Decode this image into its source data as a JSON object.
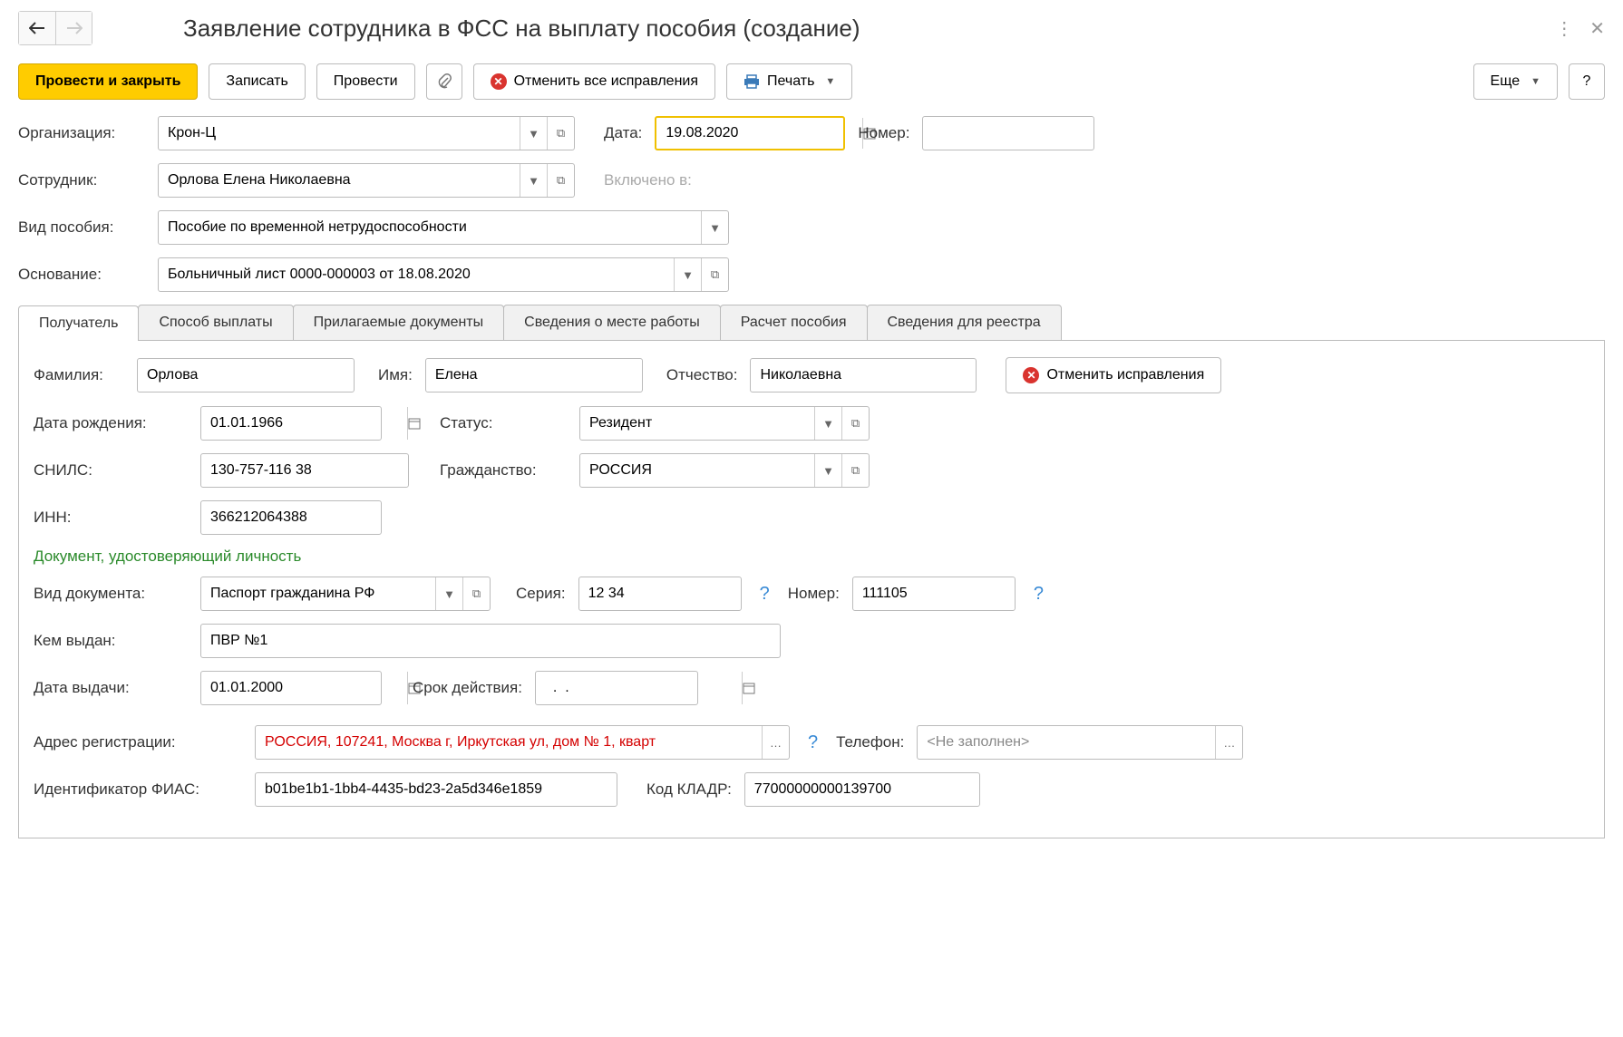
{
  "header": {
    "title": "Заявление сотрудника в ФСС на выплату пособия (создание)"
  },
  "toolbar": {
    "post_close": "Провести и закрыть",
    "save": "Записать",
    "post": "Провести",
    "undo_all": "Отменить все исправления",
    "print": "Печать",
    "more": "Еще",
    "help": "?"
  },
  "fields": {
    "org_label": "Организация:",
    "org_value": "Крон-Ц",
    "date_label": "Дата:",
    "date_value": "19.08.2020",
    "number_label": "Номер:",
    "number_value": "",
    "employee_label": "Сотрудник:",
    "employee_value": "Орлова Елена Николаевна",
    "included_label": "Включено в:",
    "benefit_label": "Вид пособия:",
    "benefit_value": "Пособие по временной нетрудоспособности",
    "basis_label": "Основание:",
    "basis_value": "Больничный лист 0000-000003 от 18.08.2020"
  },
  "tabs": {
    "t0": "Получатель",
    "t1": "Способ выплаты",
    "t2": "Прилагаемые документы",
    "t3": "Сведения о месте работы",
    "t4": "Расчет пособия",
    "t5": "Сведения для реестра"
  },
  "recipient": {
    "lastname_l": "Фамилия:",
    "lastname": "Орлова",
    "firstname_l": "Имя:",
    "firstname": "Елена",
    "middlename_l": "Отчество:",
    "middlename": "Николаевна",
    "undo": "Отменить исправления",
    "dob_l": "Дата рождения:",
    "dob": "01.01.1966",
    "status_l": "Статус:",
    "status": "Резидент",
    "snils_l": "СНИЛС:",
    "snils": "130-757-116 38",
    "citizen_l": "Гражданство:",
    "citizen": "РОССИЯ",
    "inn_l": "ИНН:",
    "inn": "366212064388",
    "id_section": "Документ, удостоверяющий личность",
    "doctype_l": "Вид документа:",
    "doctype": "Паспорт гражданина РФ",
    "series_l": "Серия:",
    "series": "12 34",
    "docnum_l": "Номер:",
    "docnum": "111105",
    "issued_l": "Кем выдан:",
    "issued": "ПВР №1",
    "idate_l": "Дата выдачи:",
    "idate": "01.01.2000",
    "exp_l": "Срок действия:",
    "exp": "  .  .",
    "addr_l": "Адрес регистрации:",
    "addr": "РОССИЯ, 107241, Москва г, Иркутская ул, дом № 1, кварт",
    "phone_l": "Телефон:",
    "phone": "<Не заполнен>",
    "fias_l": "Идентификатор ФИАС:",
    "fias": "b01be1b1-1bb4-4435-bd23-2a5d346e1859",
    "kladr_l": "Код КЛАДР:",
    "kladr": "77000000000139700"
  }
}
